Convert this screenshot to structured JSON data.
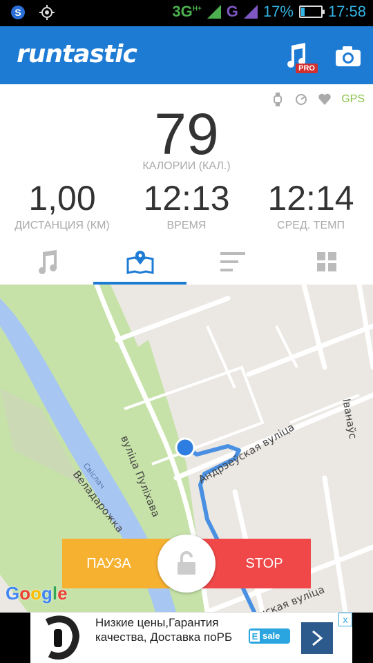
{
  "status_bar": {
    "network": "3G",
    "network_sup": "H+",
    "network2": "G",
    "battery_text": "17%",
    "battery_level": 0.17,
    "time": "17:58"
  },
  "app_bar": {
    "logo": "runtastic",
    "pro_badge": "PRO"
  },
  "sensors": {
    "gps_label": "GPS"
  },
  "stats": {
    "calories_value": "79",
    "calories_label": "КАЛОРИИ (КАЛ.)",
    "distance_value": "1,00",
    "distance_label": "ДИСТАНЦИЯ (КМ)",
    "time_value": "12:13",
    "time_label": "ВРЕМЯ",
    "pace_value": "12:14",
    "pace_label": "СРЕД. ТЕМП"
  },
  "tabs": [
    "music",
    "map",
    "stats",
    "dashboard"
  ],
  "map": {
    "streets": [
      "вуліца Пуліхава",
      "Андрэеўская вуліца",
      "Свіслач",
      "Веладарожка",
      "Іванаўс",
      "нская вуліца"
    ],
    "attribution": "Google"
  },
  "controls": {
    "pause_label": "ПАУЗА",
    "stop_label": "STOP"
  },
  "ad": {
    "text": "Низкие цены,Гарантия качества, Доставка поРБ",
    "logo_text": "sale",
    "close": "x"
  },
  "colors": {
    "brand_blue": "#1e7bd4",
    "pause_yellow": "#f7b131",
    "stop_red": "#f04848",
    "gps_green": "#8bc34a",
    "route_blue": "#4a90e2"
  }
}
